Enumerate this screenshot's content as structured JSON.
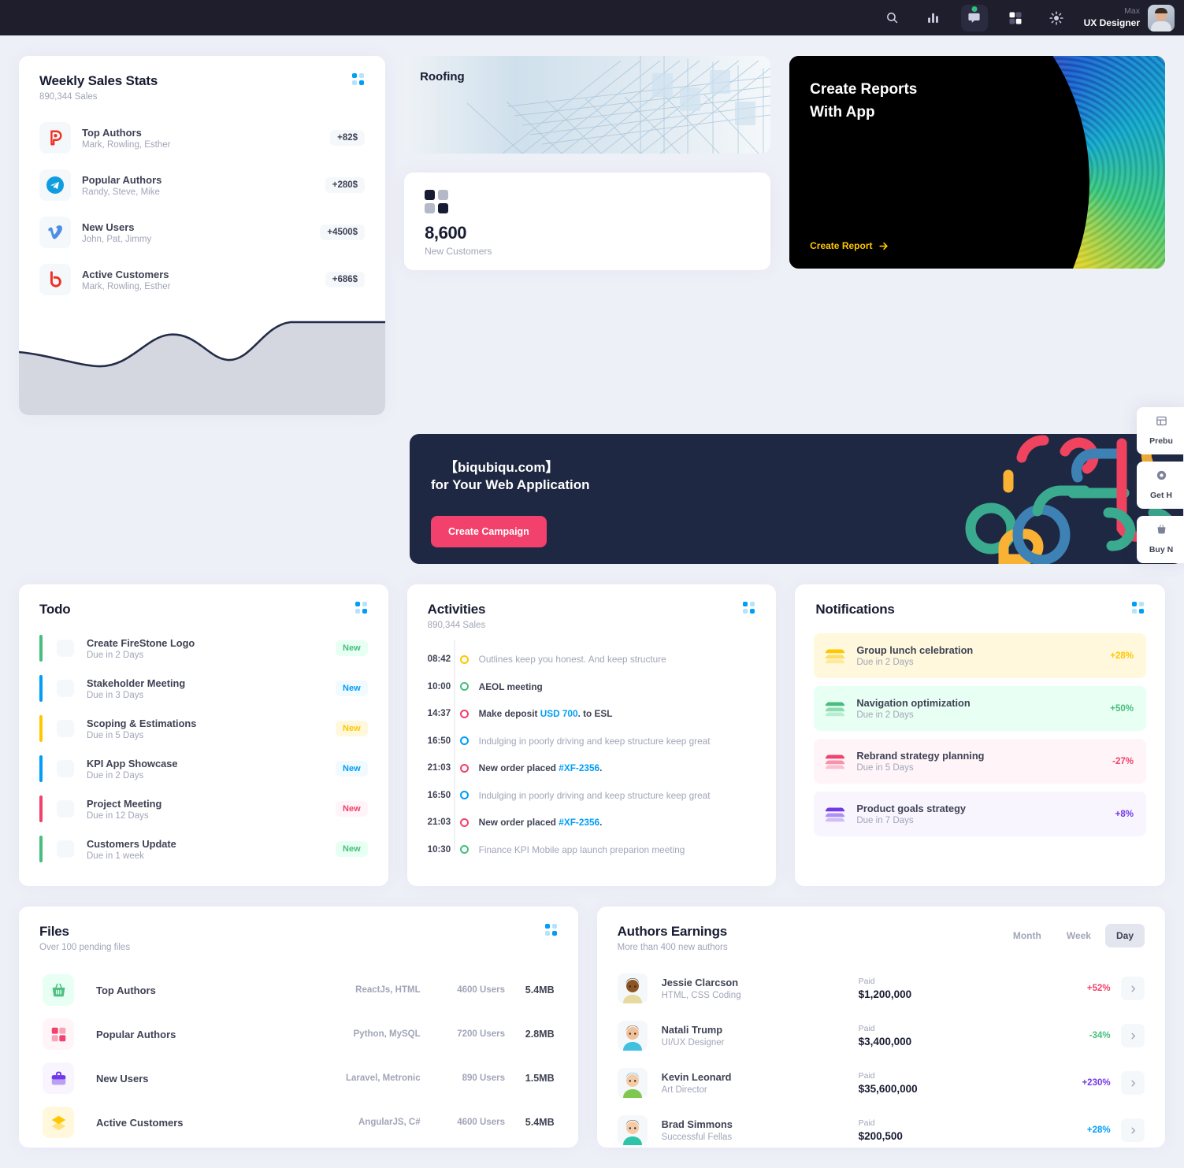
{
  "topbar": {
    "icons": [
      {
        "name": "search-icon",
        "glyph": "search"
      },
      {
        "name": "chart-bar-icon",
        "glyph": "chart"
      },
      {
        "name": "chat-icon",
        "glyph": "chat",
        "dot": true
      },
      {
        "name": "grid-apps-icon",
        "glyph": "grid"
      },
      {
        "name": "theme-brightness-icon",
        "glyph": "sun"
      }
    ],
    "user_name": "Max",
    "user_role": "UX Designer"
  },
  "weekly": {
    "title": "Weekly Sales Stats",
    "subtitle": "890,344 Sales",
    "items": [
      {
        "logo": "plurk-logo",
        "name": "Top Authors",
        "people": "Mark, Rowling, Esther",
        "value": "+82$",
        "color": "#f1416c"
      },
      {
        "logo": "telegram-logo",
        "name": "Popular Authors",
        "people": "Randy, Steve, Mike",
        "value": "+280$",
        "color": "#0088cc"
      },
      {
        "logo": "vimeo-logo",
        "name": "New Users",
        "people": "John, Pat, Jimmy",
        "value": "+4500$",
        "color": "#3b7de0"
      },
      {
        "logo": "bebo-logo",
        "name": "Active Customers",
        "people": "Mark, Rowling, Esther",
        "value": "+686$",
        "color": "#ee3124"
      }
    ]
  },
  "roofing": {
    "title": "Roofing"
  },
  "new_customers": {
    "value": "8,600",
    "label": "New Customers"
  },
  "reports": {
    "line1": "Create Reports",
    "line2": "With App",
    "link": "Create Report",
    "link_color": "#ffc700"
  },
  "campaign": {
    "line1": "【biqubiqu.com】",
    "line2": "for Your Web Application",
    "button": "Create Campaign",
    "button_color": "#f1416c"
  },
  "todo": {
    "title": "Todo",
    "items": [
      {
        "name": "Create FireStone Logo",
        "due": "Due in 2 Days",
        "badge": "New",
        "bar": "#47be7d",
        "badge_bg": "#e8fff3",
        "badge_fg": "#47be7d"
      },
      {
        "name": "Stakeholder Meeting",
        "due": "Due in 3 Days",
        "badge": "New",
        "bar": "#009ef7",
        "badge_bg": "#f1faff",
        "badge_fg": "#009ef7"
      },
      {
        "name": "Scoping & Estimations",
        "due": "Due in 5 Days",
        "badge": "New",
        "bar": "#ffc700",
        "badge_bg": "#fff8dd",
        "badge_fg": "#ffc700"
      },
      {
        "name": "KPI App Showcase",
        "due": "Due in 2 Days",
        "badge": "New",
        "bar": "#009ef7",
        "badge_bg": "#f1faff",
        "badge_fg": "#009ef7"
      },
      {
        "name": "Project Meeting",
        "due": "Due in 12 Days",
        "badge": "New",
        "bar": "#f1416c",
        "badge_bg": "#fff5f8",
        "badge_fg": "#f1416c"
      },
      {
        "name": "Customers Update",
        "due": "Due in 1 week",
        "badge": "New",
        "bar": "#47be7d",
        "badge_bg": "#e8fff3",
        "badge_fg": "#47be7d"
      }
    ]
  },
  "activities": {
    "title": "Activities",
    "subtitle": "890,344 Sales",
    "items": [
      {
        "time": "08:42",
        "dot": "#ffc700",
        "text": "Outlines keep you honest. And keep structure",
        "muted": true
      },
      {
        "time": "10:00",
        "dot": "#47be7d",
        "text": "AEOL meeting",
        "muted": false
      },
      {
        "time": "14:37",
        "dot": "#f1416c",
        "text": "Make deposit ",
        "link": "USD 700",
        "tail": ". to ESL",
        "muted": false
      },
      {
        "time": "16:50",
        "dot": "#009ef7",
        "text": "Indulging in poorly driving and keep structure keep great",
        "muted": true
      },
      {
        "time": "21:03",
        "dot": "#f1416c",
        "text": "New order placed ",
        "link": "#XF-2356",
        "tail": ".",
        "muted": false
      },
      {
        "time": "16:50",
        "dot": "#009ef7",
        "text": "Indulging in poorly driving and keep structure keep great",
        "muted": true
      },
      {
        "time": "21:03",
        "dot": "#f1416c",
        "text": "New order placed ",
        "link": "#XF-2356",
        "tail": ".",
        "muted": false
      },
      {
        "time": "10:30",
        "dot": "#47be7d",
        "text": "Finance KPI Mobile app launch preparion meeting",
        "muted": true
      }
    ]
  },
  "notifications": {
    "title": "Notifications",
    "items": [
      {
        "name": "Group lunch celebration",
        "due": "Due in 2 Days",
        "pct": "+28%",
        "bg": "#fff8dd",
        "color": "#ffc700"
      },
      {
        "name": "Navigation optimization",
        "due": "Due in 2 Days",
        "pct": "+50%",
        "bg": "#e8fff3",
        "color": "#47be7d"
      },
      {
        "name": "Rebrand strategy planning",
        "due": "Due in 5 Days",
        "pct": "-27%",
        "bg": "#fff5f8",
        "color": "#f1416c"
      },
      {
        "name": "Product goals strategy",
        "due": "Due in 7 Days",
        "pct": "+8%",
        "bg": "#f8f5ff",
        "color": "#7239ea"
      }
    ]
  },
  "files": {
    "title": "Files",
    "subtitle": "Over 100 pending files",
    "items": [
      {
        "icon": "basket-icon",
        "name": "Top Authors",
        "tech": "ReactJs, HTML",
        "users": "4600 Users",
        "size": "5.4MB",
        "bg": "#e8fff3",
        "color": "#47be7d"
      },
      {
        "icon": "grid-icon",
        "name": "Popular Authors",
        "tech": "Python, MySQL",
        "users": "7200 Users",
        "size": "2.8MB",
        "bg": "#fff5f8",
        "color": "#f1416c"
      },
      {
        "icon": "briefcase-icon",
        "name": "New Users",
        "tech": "Laravel, Metronic",
        "users": "890 Users",
        "size": "1.5MB",
        "bg": "#f8f5ff",
        "color": "#7239ea"
      },
      {
        "icon": "layers-icon",
        "name": "Active Customers",
        "tech": "AngularJS, C#",
        "users": "4600 Users",
        "size": "5.4MB",
        "bg": "#fff8dd",
        "color": "#ffc700"
      }
    ]
  },
  "earnings": {
    "title": "Authors Earnings",
    "subtitle": "More than 400 new authors",
    "tabs": [
      {
        "label": "Month",
        "active": false
      },
      {
        "label": "Week",
        "active": false
      },
      {
        "label": "Day",
        "active": true
      }
    ],
    "paid_label": "Paid",
    "items": [
      {
        "name": "Jessie Clarcson",
        "role": "HTML, CSS Coding",
        "paid": "$1,200,000",
        "pct": "+52%",
        "pct_color": "#f1416c",
        "skin": "#8d5524",
        "hair": "#2b1a12",
        "shirt": "#e7d9a0"
      },
      {
        "name": "Natali Trump",
        "role": "UI/UX Designer",
        "paid": "$3,400,000",
        "pct": "-34%",
        "pct_color": "#47be7d",
        "skin": "#f1c19a",
        "hair": "#7a4a2a",
        "shirt": "#41c0e0"
      },
      {
        "name": "Kevin Leonard",
        "role": "Art Director",
        "paid": "$35,600,000",
        "pct": "+230%",
        "pct_color": "#7239ea",
        "skin": "#f5cba7",
        "hair": "#4aa3d8",
        "shirt": "#7ec850"
      },
      {
        "name": "Brad Simmons",
        "role": "Successful Fellas",
        "paid": "$200,500",
        "pct": "+28%",
        "pct_color": "#009ef7",
        "skin": "#f5cba7",
        "hair": "#6b4226",
        "shirt": "#2ec4a8"
      }
    ]
  },
  "float_panel": {
    "items": [
      {
        "icon": "layout-icon",
        "label": "Prebu"
      },
      {
        "icon": "lifering-icon",
        "label": "Get H"
      },
      {
        "icon": "cart-icon",
        "label": "Buy N"
      }
    ]
  }
}
